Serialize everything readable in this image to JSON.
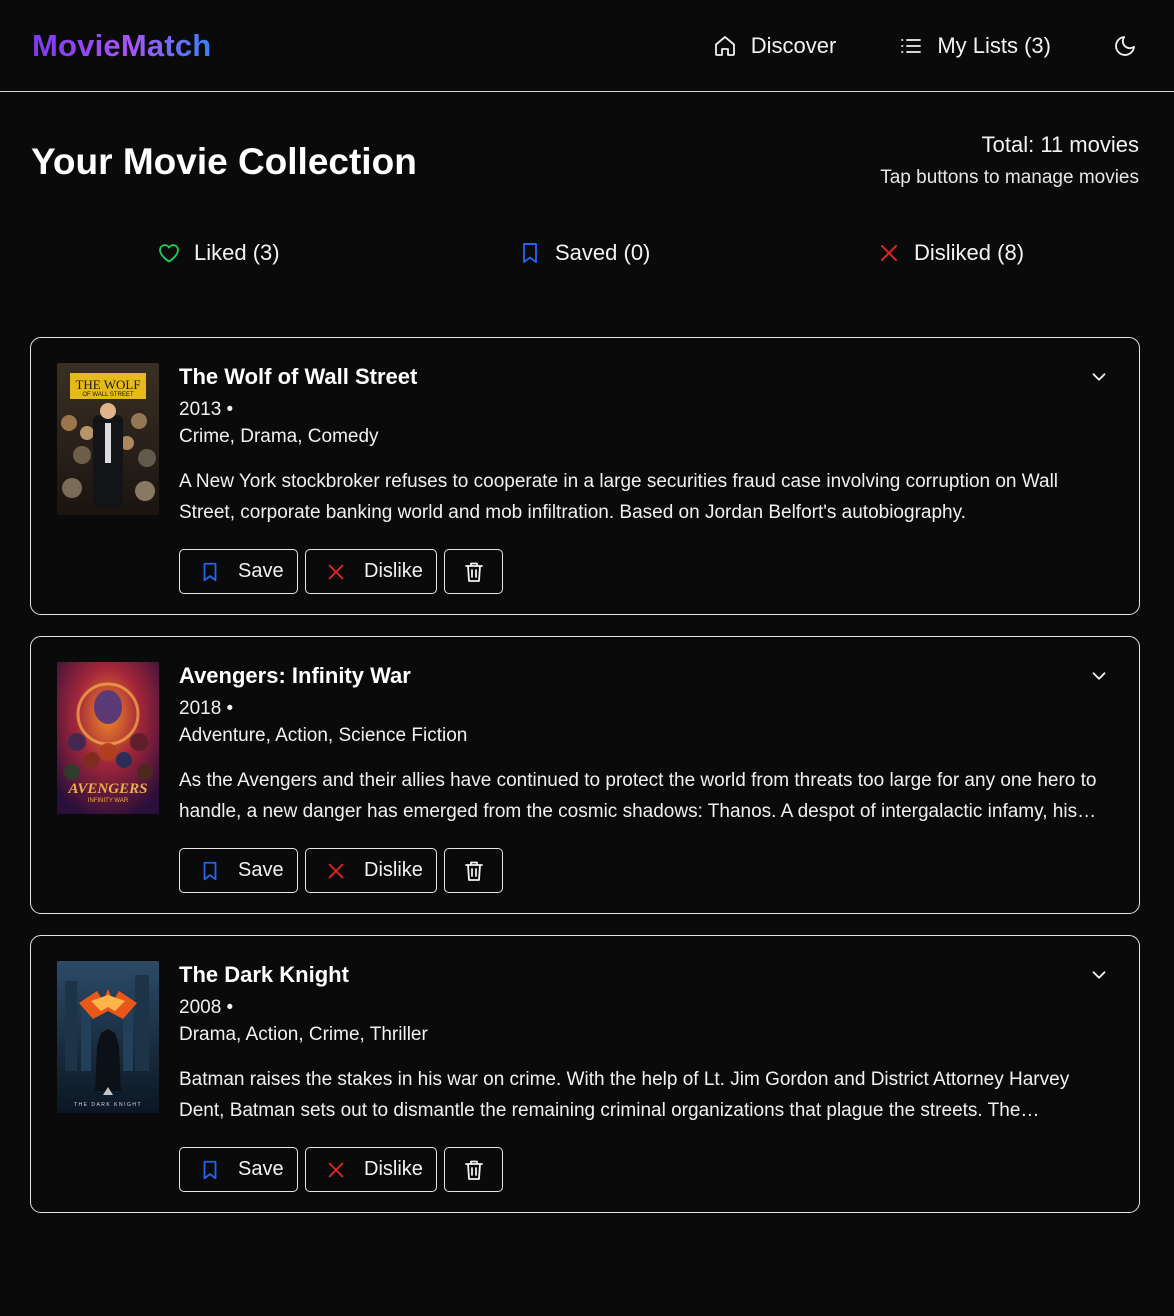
{
  "app": {
    "brand": "MovieMatch"
  },
  "nav": {
    "discover": "Discover",
    "my_lists": "My Lists (3)"
  },
  "page": {
    "title": "Your Movie Collection",
    "total": "Total: 11 movies",
    "hint": "Tap buttons to manage movies"
  },
  "filters": {
    "liked": "Liked (3)",
    "saved": "Saved (0)",
    "disliked": "Disliked (8)"
  },
  "colors": {
    "liked": "#22c55e",
    "saved": "#2563eb",
    "disliked": "#dc2626"
  },
  "movies": [
    {
      "title": "The Wolf of Wall Street",
      "year": "2013 •",
      "genres": "Crime, Drama, Comedy",
      "overview": "A New York stockbroker refuses to cooperate in a large securities fraud case involving corruption on Wall Street, corporate banking world and mob infiltration. Based on Jordan Belfort's autobiography.",
      "poster_text_1": "THE WOLF",
      "poster_text_2": "OF WALL STREET",
      "save_label": "Save",
      "dislike_label": "Dislike"
    },
    {
      "title": "Avengers: Infinity War",
      "year": "2018 •",
      "genres": "Adventure, Action, Science Fiction",
      "overview": "As the Avengers and their allies have continued to protect the world from threats too large for any one hero to handle, a new danger has emerged from the cosmic shadows: Thanos. A despot of intergalactic infamy, his goal is to collect all six Infinity Stones.",
      "poster_text_1": "AVENGERS",
      "poster_text_2": "INFINITY WAR",
      "save_label": "Save",
      "dislike_label": "Dislike"
    },
    {
      "title": "The Dark Knight",
      "year": "2008 •",
      "genres": "Drama, Action, Crime, Thriller",
      "overview": "Batman raises the stakes in his war on crime. With the help of Lt. Jim Gordon and District Attorney Harvey Dent, Batman sets out to dismantle the remaining criminal organizations that plague the streets. The partnership proves to be effective.",
      "poster_text_1": "THE DARK KNIGHT",
      "save_label": "Save",
      "dislike_label": "Dislike"
    }
  ]
}
